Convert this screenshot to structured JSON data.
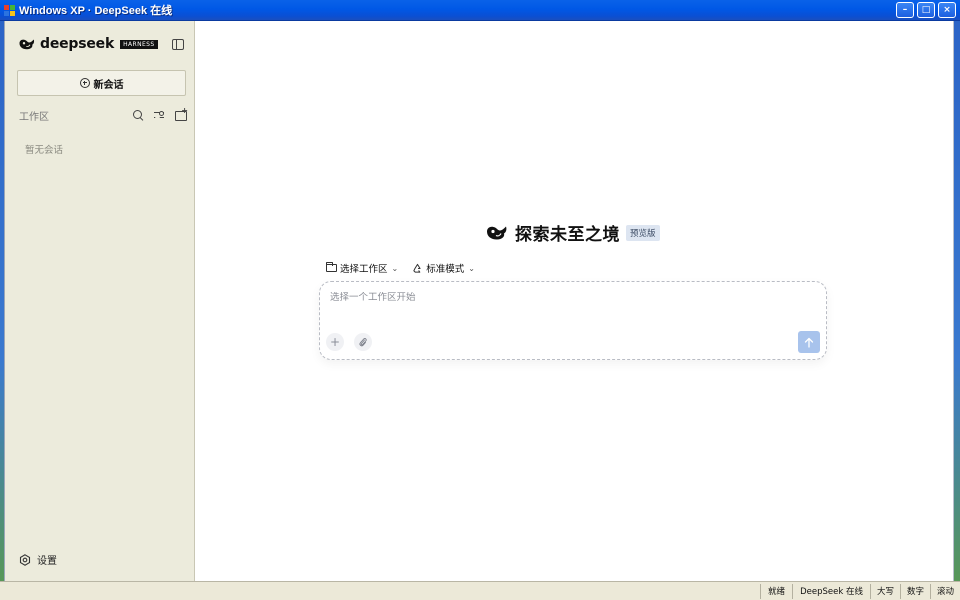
{
  "window": {
    "title": "Windows XP · DeepSeek 在线",
    "minimize_label": "–",
    "maximize_label": "□",
    "close_label": "×"
  },
  "sidebar": {
    "brand_name": "deepseek",
    "brand_tag": "HARNESS",
    "new_chat_label": "新会话",
    "workspace_label": "工作区",
    "empty_text": "暂无会话",
    "settings_label": "设置"
  },
  "main": {
    "hero_title": "探索未至之境",
    "hero_badge": "预览版",
    "workspace_select_label": "选择工作区",
    "mode_select_label": "标准模式",
    "composer_placeholder": "选择一个工作区开始",
    "add_label": "+"
  },
  "statusbar": {
    "ready": "就绪",
    "online": "DeepSeek 在线",
    "caps": "大写",
    "num": "数字",
    "scroll": "滚动"
  },
  "colors": {
    "accent_send": "#a8c3ec",
    "sidebar_bg": "#ecebdc",
    "titlebar": "#0058e6"
  }
}
